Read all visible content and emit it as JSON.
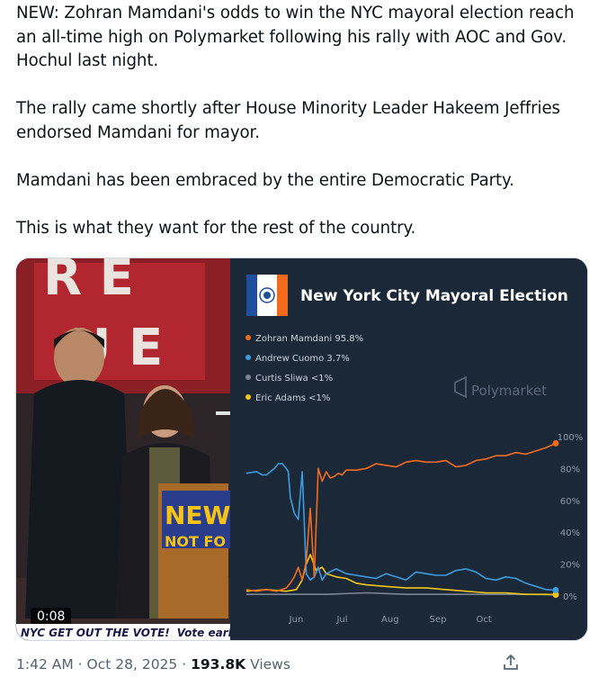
{
  "tweet": {
    "paragraphs": [
      "NEW: Zohran Mamdani's odds to win the NYC mayoral election reach an all-time high on Polymarket following his rally with AOC and Gov. Hochul last night.",
      "The rally came shortly after House Minority Leader Hakeem Jeffries endorsed Mamdani for mayor.",
      "Mamdani has been embraced by the entire Democratic Party.",
      "This is what they want for the rest of the country."
    ]
  },
  "video": {
    "duration": "0:08",
    "banner_left": "NYC GET OUT THE VOTE!",
    "banner_right": "Vote early",
    "sign_line1": "NEW",
    "sign_line2": "NOT FO"
  },
  "chart_data": {
    "type": "line",
    "title": "New York City Mayoral Election",
    "brand": "Polymarket",
    "legend": [
      "Zohran Mamdani 95.8%",
      "Andrew Cuomo 3.7%",
      "Curtis Sliwa <1%",
      "Eric Adams <1%"
    ],
    "y_ticks": [
      "100%",
      "80%",
      "60%",
      "40%",
      "20%",
      "0%"
    ],
    "x_ticks": [
      "Jun",
      "Jul",
      "Aug",
      "Sep",
      "Oct"
    ],
    "ylim": [
      0,
      100
    ],
    "grid": false,
    "legend_position": "top-left",
    "colors": {
      "Mamdani": "#f26b1d",
      "Cuomo": "#3d9be0",
      "Sliwa": "#7b8692",
      "Adams": "#f5c518"
    },
    "series": [
      {
        "name": "Zohran Mamdani",
        "x": [
          0,
          5,
          10,
          15,
          20,
          22,
          24,
          26,
          28,
          30,
          32,
          34,
          36,
          38,
          40,
          42,
          44,
          46,
          48,
          50,
          55,
          60,
          65,
          70,
          75,
          80,
          85,
          90,
          95,
          100,
          105,
          110,
          115,
          120,
          125,
          130,
          135,
          140,
          145,
          150,
          155
        ],
        "y": [
          4,
          3,
          4,
          3,
          5,
          8,
          12,
          18,
          10,
          22,
          55,
          12,
          80,
          72,
          78,
          74,
          75,
          77,
          76,
          79,
          79,
          80,
          83,
          82,
          81,
          84,
          85,
          84,
          84,
          85,
          81,
          82,
          85,
          86,
          88,
          88,
          90,
          89,
          91,
          93,
          95.8
        ]
      },
      {
        "name": "Andrew Cuomo",
        "x": [
          0,
          5,
          8,
          10,
          14,
          16,
          18,
          20,
          21,
          22,
          24,
          26,
          28,
          30,
          32,
          34,
          36,
          38,
          40,
          45,
          50,
          55,
          60,
          65,
          70,
          75,
          80,
          85,
          90,
          95,
          100,
          105,
          110,
          115,
          120,
          125,
          130,
          135,
          140,
          145,
          150,
          155
        ],
        "y": [
          77,
          78,
          76,
          76,
          80,
          83,
          83,
          80,
          78,
          62,
          52,
          48,
          78,
          14,
          10,
          12,
          18,
          10,
          14,
          17,
          14,
          13,
          12,
          11,
          14,
          12,
          10,
          15,
          14,
          13,
          13,
          16,
          17,
          15,
          11,
          10,
          12,
          11,
          8,
          6,
          4,
          3.7
        ]
      },
      {
        "name": "Curtis Sliwa",
        "x": [
          0,
          20,
          40,
          60,
          80,
          100,
          120,
          140,
          155
        ],
        "y": [
          1,
          1,
          1,
          2,
          1,
          1,
          1,
          1,
          0.8
        ]
      },
      {
        "name": "Eric Adams",
        "x": [
          0,
          10,
          20,
          25,
          28,
          30,
          32,
          35,
          38,
          40,
          45,
          50,
          55,
          60,
          70,
          80,
          90,
          100,
          110,
          120,
          130,
          140,
          150,
          155
        ],
        "y": [
          3,
          4,
          3,
          4,
          10,
          20,
          26,
          16,
          18,
          14,
          12,
          11,
          8,
          7,
          6,
          5,
          5,
          4,
          3,
          2,
          2,
          1,
          1,
          0.8
        ]
      }
    ]
  },
  "meta": {
    "time": "1:42 AM",
    "sep1": "·",
    "date": "Oct 28, 2025",
    "sep2": "·",
    "views_count": "193.8K",
    "views_label": "Views"
  }
}
